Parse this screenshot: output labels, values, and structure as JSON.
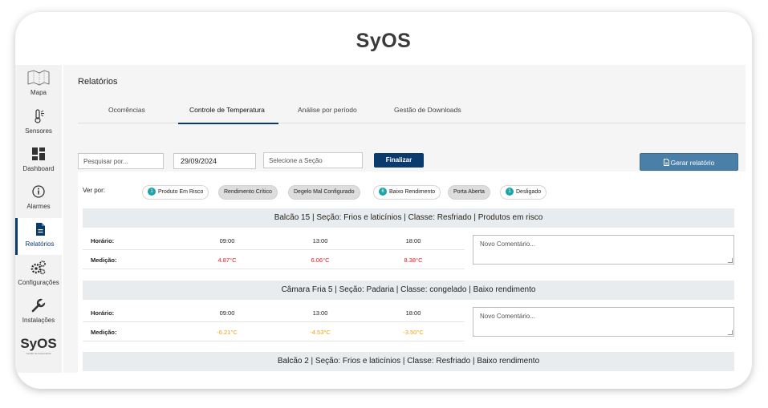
{
  "brand": {
    "name": "SyOS",
    "tagline": "Gestão de temperatura"
  },
  "sidebar": {
    "items": [
      {
        "label": "Mapa",
        "icon": "map-icon"
      },
      {
        "label": "Sensores",
        "icon": "thermometer-icon"
      },
      {
        "label": "Dashboard",
        "icon": "dashboard-icon"
      },
      {
        "label": "Alarmes",
        "icon": "info-icon"
      },
      {
        "label": "Relatórios",
        "icon": "document-icon",
        "active": true
      },
      {
        "label": "Configurações",
        "icon": "gears-icon"
      },
      {
        "label": "Instalações",
        "icon": "wrench-icon"
      }
    ]
  },
  "page": {
    "title": "Relatórios"
  },
  "tabs": [
    {
      "label": "Ocorrências"
    },
    {
      "label": "Controle de Temperatura",
      "active": true
    },
    {
      "label": "Análise por período"
    },
    {
      "label": "Gestão de Downloads"
    }
  ],
  "filters": {
    "search_placeholder": "Pesquisar por...",
    "date_value": "29/09/2024",
    "section_placeholder": "Selecione a Seção",
    "finalize_label": "Finalizar",
    "report_label": "Gerar relatório"
  },
  "view_by": {
    "label": "Ver por:",
    "chips": [
      {
        "count": "1",
        "label": "Produto Em Risco",
        "style": "outline"
      },
      {
        "count": "",
        "label": "Rendimento Crítico",
        "style": "filled"
      },
      {
        "count": "",
        "label": "Degelo Mal Configurado",
        "style": "filled"
      },
      {
        "count": "6",
        "label": "Baixo Rendimento",
        "style": "outline"
      },
      {
        "count": "",
        "label": "Porta Aberta",
        "style": "filled"
      },
      {
        "count": "1",
        "label": "Desligado",
        "style": "outline"
      }
    ]
  },
  "sections": [
    {
      "title": "Balcão 15 | Seção: Frios e laticínios | Classe: Resfriado | Produtos em risco",
      "time_label": "Horário:",
      "measure_label": "Medição:",
      "times": [
        "09:00",
        "13:00",
        "18:00"
      ],
      "measurements": [
        "4.87°C",
        "6.06°C",
        "8.38°C"
      ],
      "measurement_color": "#e01b24",
      "comment_placeholder": "Novo Comentário..."
    },
    {
      "title": "Câmara Fria 5 | Seção: Padaria | Classe: congelado | Baixo rendimento",
      "time_label": "Horário:",
      "measure_label": "Medição:",
      "times": [
        "09:00",
        "13:00",
        "18:00"
      ],
      "measurements": [
        "-6.21°C",
        "-4.53°C",
        "-3.50°C"
      ],
      "measurement_color": "#f2a20c",
      "comment_placeholder": "Novo Comentário..."
    },
    {
      "title": "Balcão 2 | Seção: Frios e laticínios | Classe: Resfriado | Baixo rendimento"
    }
  ]
}
